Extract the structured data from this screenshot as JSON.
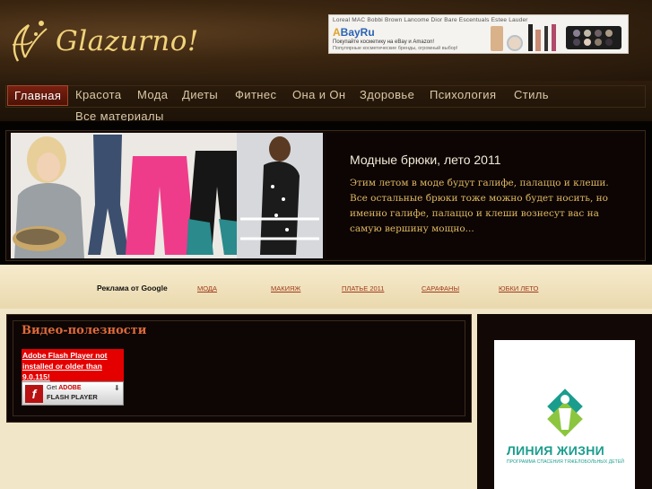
{
  "site": {
    "logo_text": "Glazurno!"
  },
  "banner": {
    "brands": "Loreal  MAC  Bobbi Brown  Lancome  Dior  Bare Escentuals  Estee Lauder",
    "logo": "BayRu",
    "line1": "Покупайте косметику на eBay и Amazon!",
    "line2": "Популярные косметические бренды, огромный выбор!"
  },
  "nav": {
    "items": [
      {
        "label": "Главная",
        "active": true
      },
      {
        "label": "Красота"
      },
      {
        "label": "Мода"
      },
      {
        "label": "Диеты"
      },
      {
        "label": "Фитнес"
      },
      {
        "label": "Она и Он"
      },
      {
        "label": "Здоровье"
      },
      {
        "label": "Психология"
      },
      {
        "label": "Стиль"
      },
      {
        "label": "Все материалы"
      }
    ]
  },
  "featured": {
    "title": "Модные брюки, лето 2011",
    "description": "Этим летом в моде будут галифе, палаццо и клеши. Все остальные брюки тоже можно будет носить, но именно галифе, палаццо и клеши вознесут вас на самую вершину мощно..."
  },
  "links_strip": {
    "ads_label": "Реклама от Google",
    "links": [
      "МОДА",
      "МАКИЯЖ",
      "ПЛАТЬЕ 2011",
      "САРАФАНЫ",
      "ЮБКИ ЛЕТО"
    ]
  },
  "video": {
    "title": "Видео-полезности",
    "flash_message": "Adobe Flash Player not installed or older than 9.0.115!",
    "badge_get": "Get",
    "badge_adobe": "ADOBE",
    "badge_player": "FLASH PLAYER"
  },
  "sidebar_ad": {
    "title": "ЛИНИЯ ЖИЗНИ",
    "subtitle": "ПРОГРАММА СПАСЕНИЯ ТЯЖЕЛОБОЛЬНЫХ ДЕТЕЙ"
  },
  "colors": {
    "accent": "#e06a3a",
    "nav_active": "#7a2010",
    "link": "#a13a1c",
    "gold": "#f1d37b",
    "lz_teal": "#1b9d8e"
  }
}
